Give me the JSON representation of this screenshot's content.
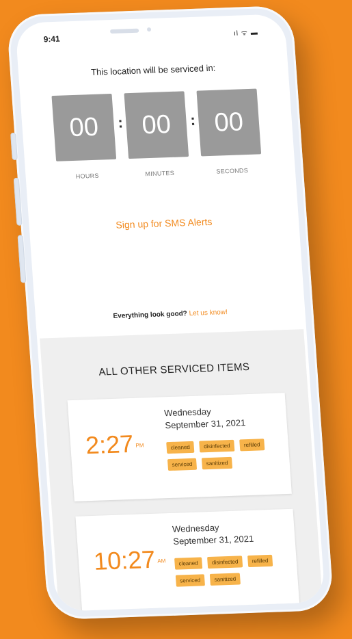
{
  "status_bar": {
    "time": "9:41",
    "icons": "ıl ᯤ ▬"
  },
  "countdown": {
    "heading": "This location will be serviced in:",
    "hours": "00",
    "minutes": "00",
    "seconds": "00",
    "separator": ":",
    "labels": {
      "hours": "HOURS",
      "minutes": "MINUTES",
      "seconds": "SECONDS"
    }
  },
  "sms_link": "Sign up for SMS Alerts",
  "feedback": {
    "prompt": "Everything look good?",
    "link": "Let us know!"
  },
  "serviced_items": {
    "title": "ALL OTHER SERVICED ITEMS",
    "items": [
      {
        "time": "2:27",
        "ampm": "PM",
        "day": "Wednesday",
        "date": "September 31, 2021",
        "tags": [
          "cleaned",
          "disinfected",
          "refilled",
          "serviced",
          "sanitized"
        ]
      },
      {
        "time": "10:27",
        "ampm": "AM",
        "day": "Wednesday",
        "date": "September 31, 2021",
        "tags": [
          "cleaned",
          "disinfected",
          "refilled",
          "serviced",
          "sanitized"
        ]
      }
    ]
  },
  "colors": {
    "background": "#F28A1E",
    "accent": "#F28A1E",
    "tag": "#F7B34A",
    "timer_box": "#9A9A9A"
  }
}
